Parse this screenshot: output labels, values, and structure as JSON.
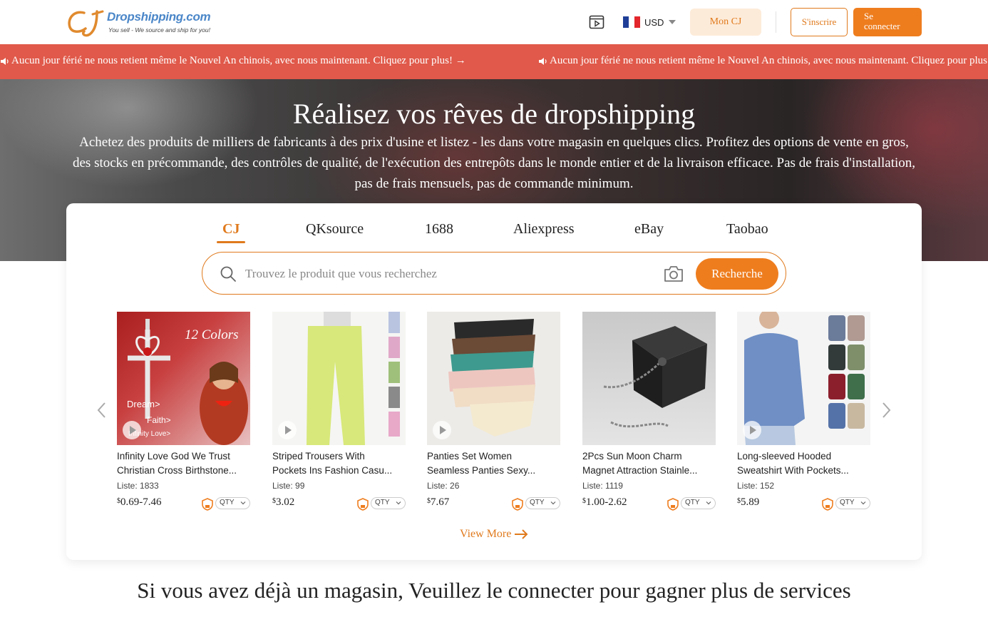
{
  "header": {
    "logo_name": "Dropshipping.com",
    "logo_tagline": "You sell - We source and ship for you!",
    "currency": "USD",
    "mon_cj": "Mon CJ",
    "signup": "S'inscrire",
    "login_line1": "Se",
    "login_line2": "connecter"
  },
  "banner": {
    "message": "Aucun jour férié ne nous retient même le Nouvel An chinois, avec nous maintenant. Cliquez pour plus! →",
    "message_repeat": "Aucun jour férié ne nous retient même le Nouvel An chinois, avec nous maintenant. Cliquez pour plus! →"
  },
  "hero": {
    "title": "Réalisez vos rêves de dropshipping",
    "description": "Achetez des produits de milliers de fabricants à des prix d'usine et listez - les dans votre magasin en quelques clics. Profitez des options de vente en gros, des stocks en précommande, des contrôles de qualité, de l'exécution des entrepôts dans le monde entier et de la livraison efficace. Pas de frais d'installation, pas de frais mensuels, pas de commande minimum."
  },
  "search": {
    "tabs": [
      "CJ",
      "QKsource",
      "1688",
      "Aliexpress",
      "eBay",
      "Taobao"
    ],
    "active_tab": "CJ",
    "placeholder": "Trouvez le produit que vous recherchez",
    "button": "Recherche"
  },
  "products": [
    {
      "title1": "Infinity Love God We Trust",
      "title2": "Christian Cross Birthstone...",
      "list_label": "Liste:",
      "list_count": "1833",
      "price": "0.69-7.46",
      "qty": "QTY",
      "img_text1": "12 Colors",
      "img_text2": "Dream>",
      "img_text3": "Faith>",
      "img_text4": "Infinity Love>"
    },
    {
      "title1": "Striped Trousers With",
      "title2": "Pockets Ins Fashion Casu...",
      "list_label": "Liste:",
      "list_count": "99",
      "price": "3.02",
      "qty": "QTY"
    },
    {
      "title1": "Panties Set Women",
      "title2": "Seamless Panties Sexy...",
      "list_label": "Liste:",
      "list_count": "26",
      "price": "7.67",
      "qty": "QTY"
    },
    {
      "title1": "2Pcs Sun Moon Charm",
      "title2": "Magnet Attraction Stainle...",
      "list_label": "Liste:",
      "list_count": "1119",
      "price": "1.00-2.62",
      "qty": "QTY"
    },
    {
      "title1": "Long-sleeved Hooded",
      "title2": "Sweatshirt With Pockets...",
      "list_label": "Liste:",
      "list_count": "152",
      "price": "5.89",
      "qty": "QTY"
    }
  ],
  "currency_symbol": "$",
  "view_more": "View More",
  "bottom_title": "Si vous avez déjà un magasin, Veuillez le connecter pour gagner plus de services",
  "colors": {
    "accent": "#ee7d1e",
    "banner": "#e0594a",
    "logo_blue": "#4a86c8"
  },
  "icons": [
    "cj-logo-icon",
    "video-icon",
    "france-flag-icon",
    "caret-down-icon",
    "speaker-icon",
    "search-icon",
    "camera-icon",
    "arrow-left-icon",
    "arrow-right-icon",
    "play-icon",
    "shield-icon",
    "chevron-down-icon",
    "arrow-right-small-icon"
  ]
}
